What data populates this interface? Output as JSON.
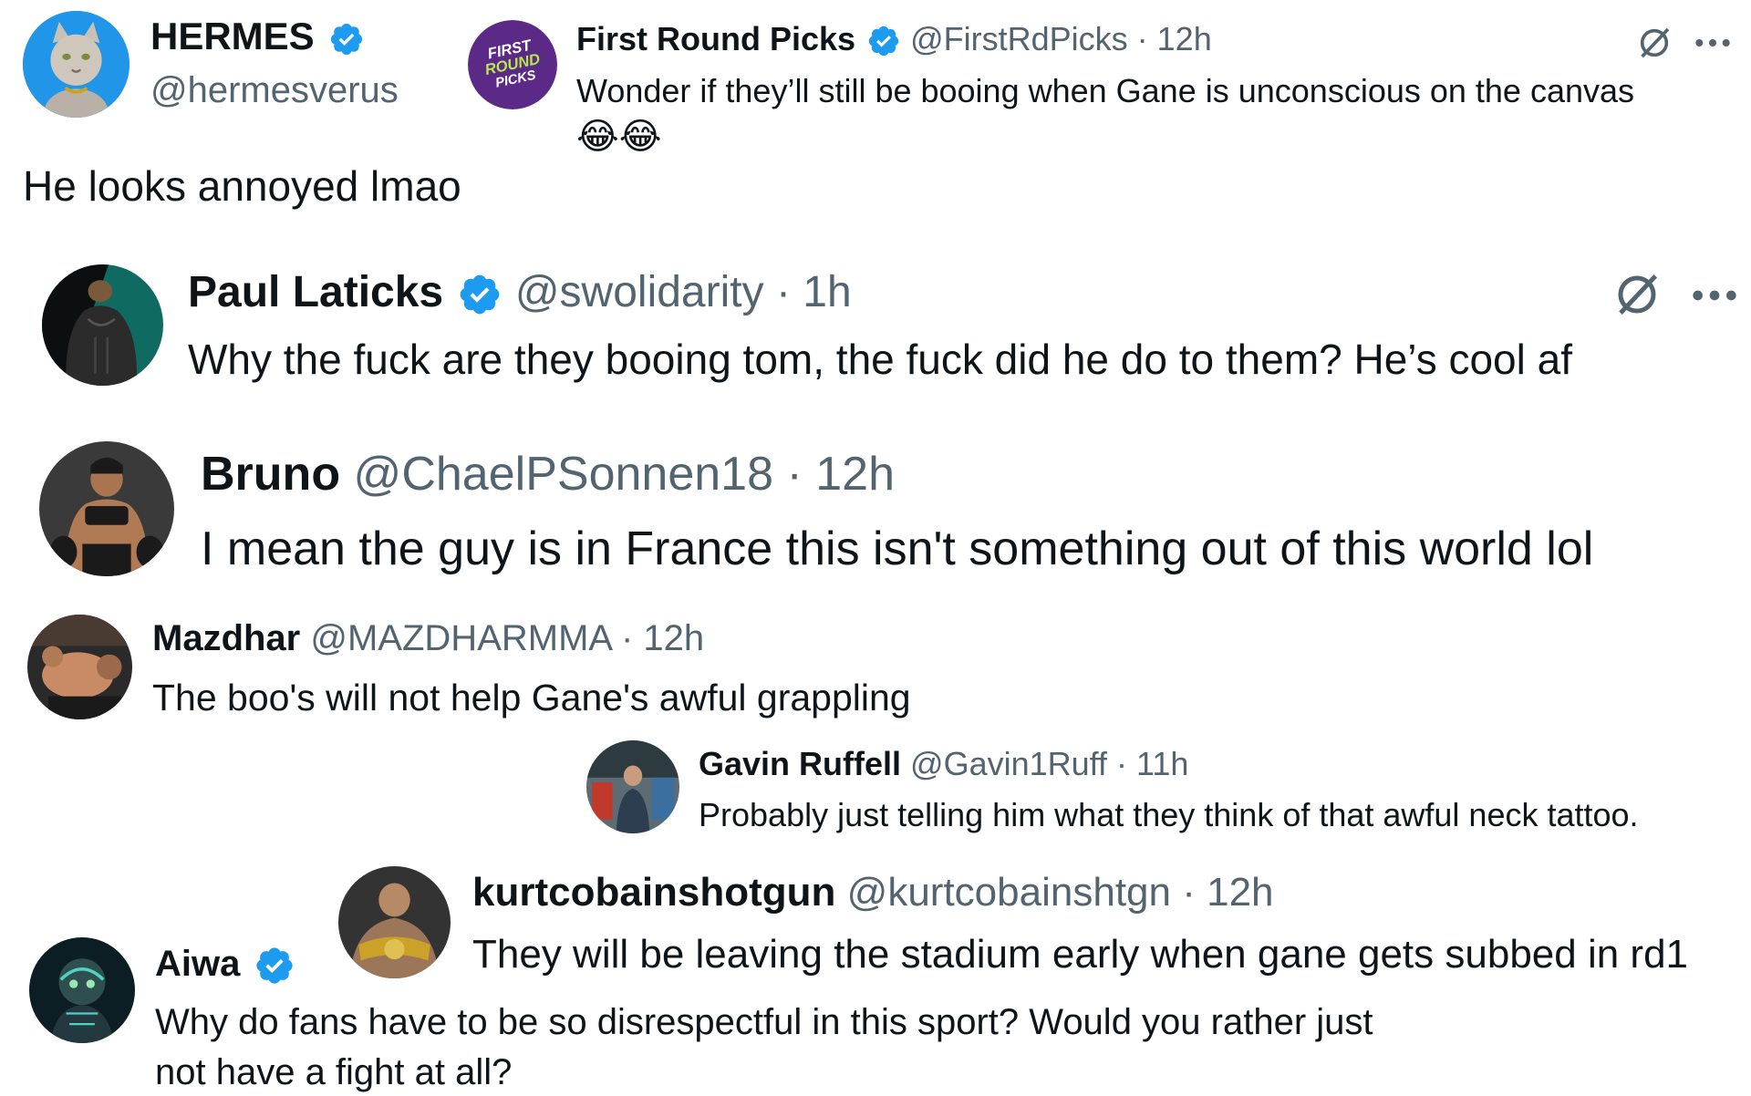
{
  "colors": {
    "verified": "#1d9bf0",
    "meta": "#536471",
    "text": "#0f1419"
  },
  "icons": {
    "verified": "verified-badge-icon",
    "grok": "grok-icon",
    "more": "more-icon"
  },
  "tweets": {
    "hermes": {
      "name": "HERMES",
      "handle": "@hermesverus",
      "text": "He looks annoyed lmao"
    },
    "firstround": {
      "name": "First Round Picks",
      "handle": "@FirstRdPicks",
      "time": "· 12h",
      "text": "Wonder if they’ll still be booing when Gane is unconscious on the canvas",
      "emoji": "😂😂",
      "avatar_text": [
        "FIRST",
        "ROUND",
        "PICKS"
      ]
    },
    "paul": {
      "name": "Paul Laticks",
      "handle": "@swolidarity",
      "time": "· 1h",
      "text": "Why the fuck are they booing tom, the fuck did he do to them? He’s cool af"
    },
    "bruno": {
      "name": "Bruno",
      "handle": "@ChaelPSonnen18",
      "time": "· 12h",
      "text": "I mean the guy is in France this isn't something out of this world lol"
    },
    "mazdhar": {
      "name": "Mazdhar",
      "handle": "@MAZDHARMMA",
      "time": "· 12h",
      "text": "The boo's will not help Gane's awful grappling"
    },
    "gavin": {
      "name": "Gavin Ruffell",
      "handle": "@Gavin1Ruff",
      "time": "· 11h",
      "text": "Probably just telling him what they think of that awful neck tattoo."
    },
    "kurt": {
      "name": "kurtcobainshotgun",
      "handle": "@kurtcobainshtgn",
      "time": "· 12h",
      "text": "They will be leaving the stadium early when gane gets subbed in rd1"
    },
    "aiwa": {
      "name": "Aiwa",
      "text_line1": "Why do fans have to be so disrespectful in this sport? Would you rather just",
      "text_line2": "not have a fight at all?"
    }
  }
}
